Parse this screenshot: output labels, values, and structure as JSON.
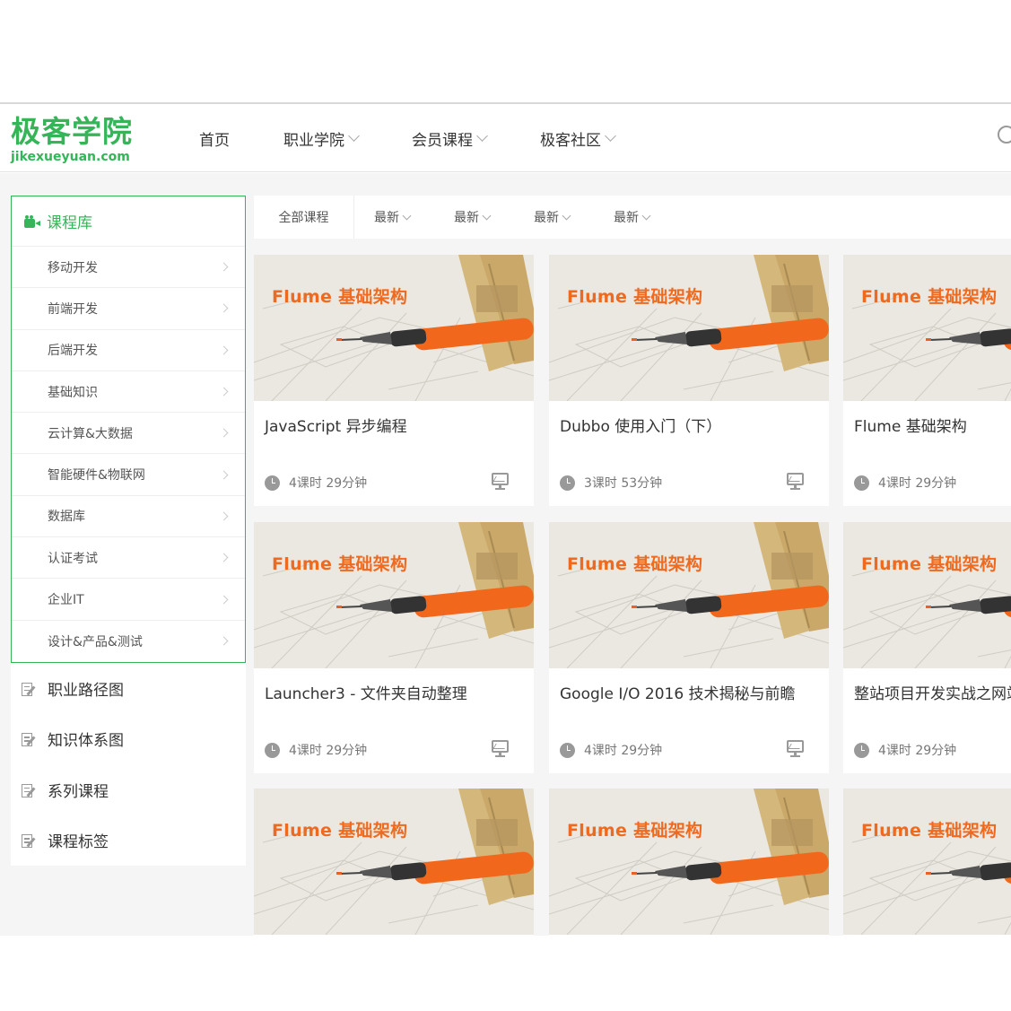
{
  "header": {
    "logo_cn": "极客学院",
    "logo_en": "jikexueyuan.com",
    "nav": [
      {
        "label": "首页",
        "dropdown": false
      },
      {
        "label": "职业学院",
        "dropdown": true
      },
      {
        "label": "会员课程",
        "dropdown": true
      },
      {
        "label": "极客社区",
        "dropdown": true
      }
    ]
  },
  "sidebar": {
    "library_title": "课程库",
    "categories": [
      "移动开发",
      "前端开发",
      "后端开发",
      "基础知识",
      "云计算&大数据",
      "智能硬件&物联网",
      "数据库",
      "认证考试",
      "企业IT",
      "设计&产品&测试"
    ],
    "links": [
      "职业路径图",
      "知识体系图",
      "系列课程",
      "课程标签"
    ]
  },
  "tabs": {
    "all": "全部课程",
    "sorts": [
      "最新",
      "最新",
      "最新",
      "最新"
    ]
  },
  "colors": {
    "brand": "#35b558",
    "thumb_title": "#ef6a1f"
  },
  "courses": [
    {
      "thumb_title": "Flume 基础架构",
      "title": "JavaScript 异步编程",
      "meta": "4课时 29分钟"
    },
    {
      "thumb_title": "Flume 基础架构",
      "title": "Dubbo 使用入门（下）",
      "meta": "3课时 53分钟"
    },
    {
      "thumb_title": "Flume 基础架构",
      "title": "Flume 基础架构",
      "meta": "4课时 29分钟"
    },
    {
      "thumb_title": "Flume 基础架构",
      "title": "Launcher3 - 文件夹自动整理",
      "meta": "4课时 29分钟"
    },
    {
      "thumb_title": "Flume 基础架构",
      "title": "Google I/O 2016 技术揭秘与前瞻",
      "meta": "4课时 29分钟"
    },
    {
      "thumb_title": "Flume 基础架构",
      "title": "整站项目开发实战之网站搭建",
      "meta": "4课时 29分钟"
    },
    {
      "thumb_title": "Flume 基础架构",
      "title": "",
      "meta": ""
    },
    {
      "thumb_title": "Flume 基础架构",
      "title": "",
      "meta": ""
    },
    {
      "thumb_title": "Flume 基础架构",
      "title": "",
      "meta": ""
    }
  ]
}
